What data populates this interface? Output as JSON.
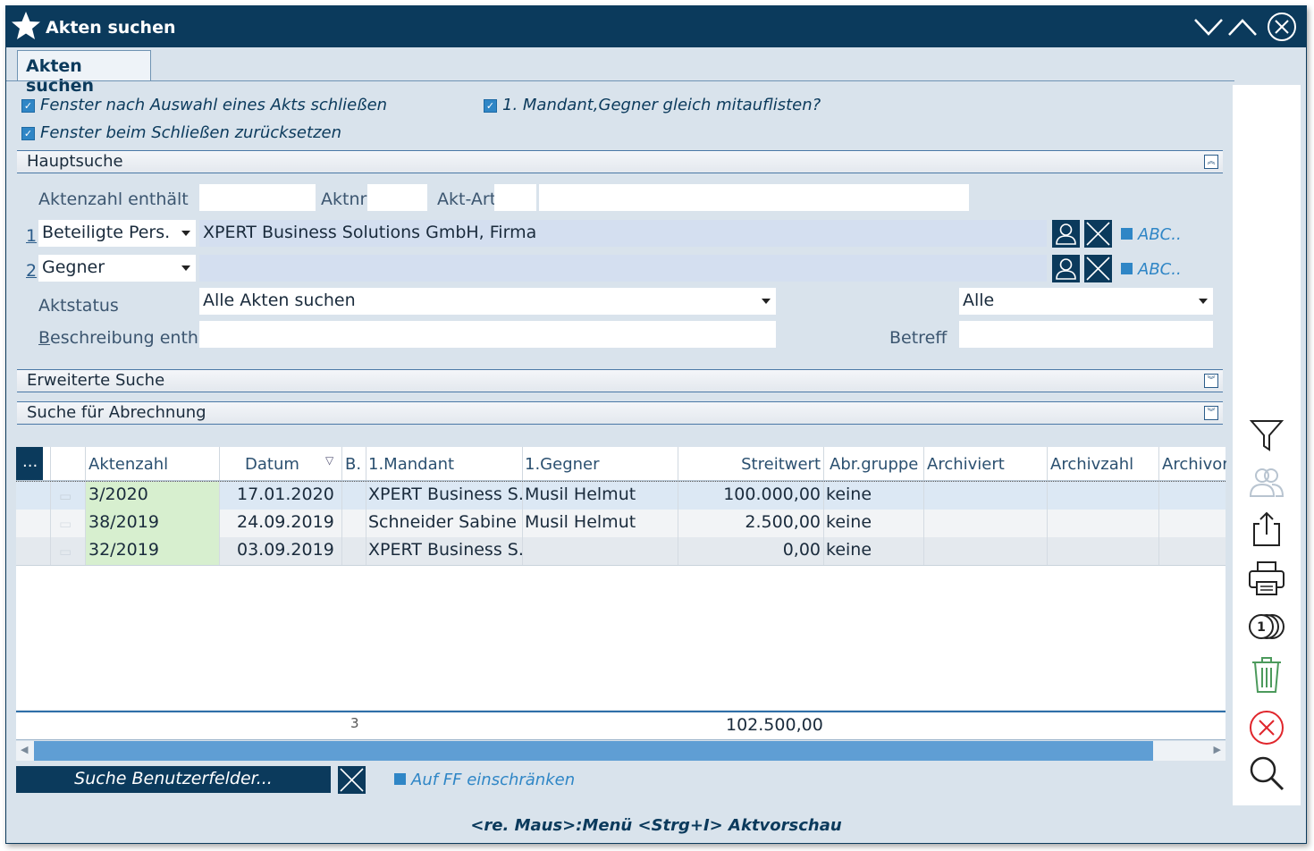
{
  "window": {
    "title": "Akten suchen",
    "controls": {
      "minimize": "chevron-down-icon",
      "maximize": "chevron-up-icon",
      "close": "close-circle-icon"
    }
  },
  "tabs": [
    {
      "label": "Akten suchen"
    }
  ],
  "options": {
    "close_after_select": "Fenster nach Auswahl eines Akts schließen",
    "reset_on_close": "Fenster beim Schließen zurücksetzen",
    "list_client_opponent": "1. Mandant,Gegner gleich mitauflisten?"
  },
  "sections": {
    "main": "Hauptsuche",
    "extended": "Erweiterte Suche",
    "billing": "Suche für Abrechnung"
  },
  "main_search": {
    "file_number_label": "Aktenzahl enthält",
    "file_number_value": "",
    "aktnr_label": "Aktnr",
    "aktnr_value": "",
    "aktart_label": "Akt-Art",
    "aktart_value": "",
    "aktart_desc": "",
    "party1_index": "1",
    "party1_role": "Beteiligte Pers.",
    "party1_value": "XPERT Business Solutions GmbH, Firma",
    "party1_abc": "ABC..",
    "party2_index": "2",
    "party2_role": "Gegner",
    "party2_value": "",
    "party2_abc": "ABC..",
    "status_label": "Aktstatus",
    "status_value": "Alle Akten suchen",
    "status_filter": "Alle",
    "description_label_u": "B",
    "description_label_rest": "eschreibung enth.",
    "description_value": "",
    "subject_label": "Betreff",
    "subject_value": ""
  },
  "results": {
    "corner_label": "...",
    "columns": [
      "Aktenzahl",
      "Datum",
      "B.",
      "1.Mandant",
      "1.Gegner",
      "Streitwert",
      "Abr.gruppe",
      "Archiviert",
      "Archivzahl",
      "Archivor"
    ],
    "sort_icon": "sort-desc-icon",
    "rows": [
      {
        "aktenzahl": "3/2020",
        "datum": "17.01.2020",
        "b": "",
        "mandant": "XPERT Business S...",
        "gegner": "Musil Helmut",
        "streitwert": "100.000,00",
        "abr": "keine",
        "archiviert": "",
        "archivzahl": "",
        "archivor": ""
      },
      {
        "aktenzahl": "38/2019",
        "datum": "24.09.2019",
        "b": "",
        "mandant": "Schneider Sabine",
        "gegner": "Musil Helmut",
        "streitwert": "2.500,00",
        "abr": "keine",
        "archiviert": "",
        "archivzahl": "",
        "archivor": ""
      },
      {
        "aktenzahl": "32/2019",
        "datum": "03.09.2019",
        "b": "",
        "mandant": "XPERT Business S...",
        "gegner": "",
        "streitwert": "0,00",
        "abr": "keine",
        "archiviert": "",
        "archivzahl": "",
        "archivor": ""
      }
    ],
    "count": "3",
    "total_streitwert": "102.500,00"
  },
  "bottom": {
    "custom_fields_button": "Suche Benutzerfelder...",
    "restrict_ff": "Auf FF einschränken"
  },
  "footer_hint": "<re. Maus>:Menü  <Strg+I> Aktvorschau",
  "toolbar_icons": [
    "filter-icon",
    "persons-icon",
    "export-icon",
    "print-icon",
    "coins-icon",
    "trash-icon",
    "cancel-icon",
    "search-icon"
  ],
  "colors": {
    "titlebar": "#0b3a5c",
    "accent": "#2f86c6",
    "file_cell": "#d7efcf",
    "selected_row": "#dce8f4"
  }
}
